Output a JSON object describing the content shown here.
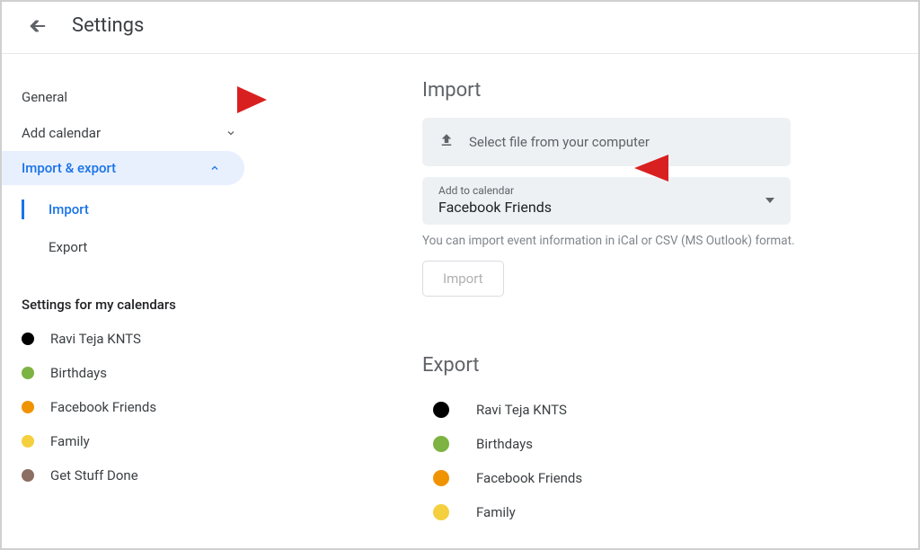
{
  "header": {
    "title": "Settings"
  },
  "sidebar": {
    "general": "General",
    "add_calendar": "Add calendar",
    "import_export": "Import & export",
    "sub_import": "Import",
    "sub_export": "Export",
    "section_my_calendars": "Settings for my calendars",
    "calendars": [
      {
        "label": "Ravi Teja KNTS",
        "color": "#000000"
      },
      {
        "label": "Birthdays",
        "color": "#7cb342"
      },
      {
        "label": "Facebook Friends",
        "color": "#f09300"
      },
      {
        "label": "Family",
        "color": "#f4d03f"
      },
      {
        "label": "Get Stuff Done",
        "color": "#8d6e63"
      }
    ]
  },
  "import": {
    "heading": "Import",
    "file_select_label": "Select file from your computer",
    "dropdown_label": "Add to calendar",
    "dropdown_value": "Facebook Friends",
    "hint": "You can import event information in iCal or CSV (MS Outlook) format.",
    "button": "Import"
  },
  "export": {
    "heading": "Export",
    "calendars": [
      {
        "label": "Ravi Teja KNTS",
        "color": "#000000"
      },
      {
        "label": "Birthdays",
        "color": "#7cb342"
      },
      {
        "label": "Facebook Friends",
        "color": "#f09300"
      },
      {
        "label": "Family",
        "color": "#f4d03f"
      }
    ]
  },
  "colors": {
    "black": "#000000",
    "green": "#7cb342",
    "orange": "#f09300",
    "yellow": "#f4d03f",
    "brown": "#8d6e63"
  }
}
